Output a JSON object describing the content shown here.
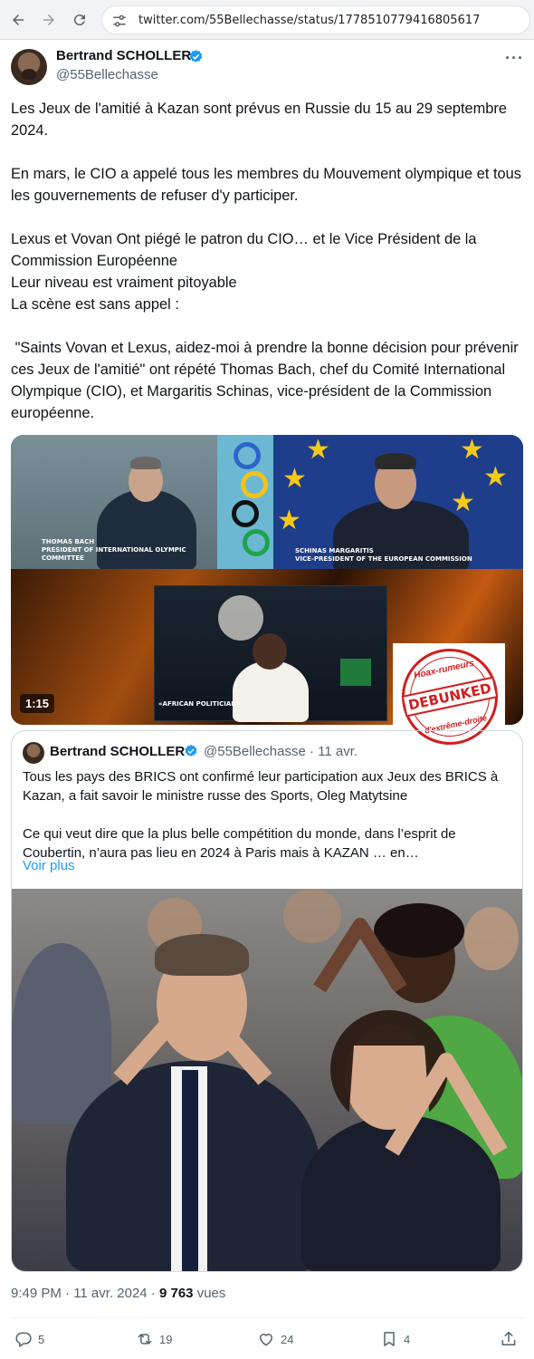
{
  "browser": {
    "url": "twitter.com/55Bellechasse/status/1778510779416805617"
  },
  "tweet": {
    "author_name": "Bertrand SCHOLLER",
    "author_handle": "@55Bellechasse",
    "paragraphs": [
      "Les Jeux de l'amitié à Kazan sont prévus en Russie du 15 au 29 septembre 2024.",
      "En mars, le CIO a appelé tous les membres du Mouvement olympique et tous les gouvernements de refuser d'y participer.",
      "Lexus et Vovan Ont piégé le patron du CIO… et le Vice Président de la Commission Européenne",
      "Leur niveau est vraiment pitoyable",
      "La scène est sans appel :",
      " \"Saints Vovan et Lexus, aidez-moi à prendre la bonne décision pour prévenir ces Jeux de l'amitié\" ont répété Thomas Bach, chef du Comité International Olympique (CIO), et Margaritis Schinas, vice-président de la Commission européenne."
    ],
    "video": {
      "duration": "1:15",
      "caption_left_name": "THOMAS BACH",
      "caption_left_role": "PRESIDENT OF INTERNATIONAL OLYMPIC COMMITTEE",
      "caption_right_name": "SCHINAS MARGARITIS",
      "caption_right_role": "VICE-PRESIDENT OF THE EUROPEAN COMMISSION",
      "caption_bottom": "«AFRICAN POLITICIAN»"
    },
    "stamp": {
      "top": "Hoax-rumeurs",
      "middle": "DEBUNKED",
      "bottom": "d'extrême-droite"
    },
    "quote": {
      "author_name": "Bertrand SCHOLLER",
      "author_handle": "@55Bellechasse · 11 avr.",
      "paragraph_1": "Tous les pays des BRICS ont confirmé leur participation aux Jeux des BRICS à Kazan, a fait savoir le ministre russe des Sports, Oleg Matytsine",
      "paragraph_2": "Ce qui veut dire que la plus belle compétition du monde, dans l’esprit de Coubertin, n’aura pas lieu en 2024 à Paris mais à KAZAN … en…",
      "show_more": "Voir plus"
    },
    "time": "9:49 PM · 11 avr. 2024 · ",
    "views_count": "9 763",
    "views_label": " vues",
    "actions": {
      "replies": "5",
      "retweets": "19",
      "likes": "24",
      "bookmarks": "4"
    }
  },
  "icons": {
    "back": "arrow-left-icon",
    "forward": "arrow-right-icon",
    "reload": "reload-icon",
    "site_settings": "tune-icon",
    "verified": "verified-badge-icon",
    "more": "more-horizontal-icon",
    "reply": "reply-icon",
    "retweet": "retweet-icon",
    "like": "heart-icon",
    "bookmark": "bookmark-icon",
    "share": "share-icon"
  },
  "colors": {
    "accent": "#1d9bf0",
    "text": "#0f1419",
    "secondary": "#536471",
    "stamp": "#d11e1e"
  }
}
